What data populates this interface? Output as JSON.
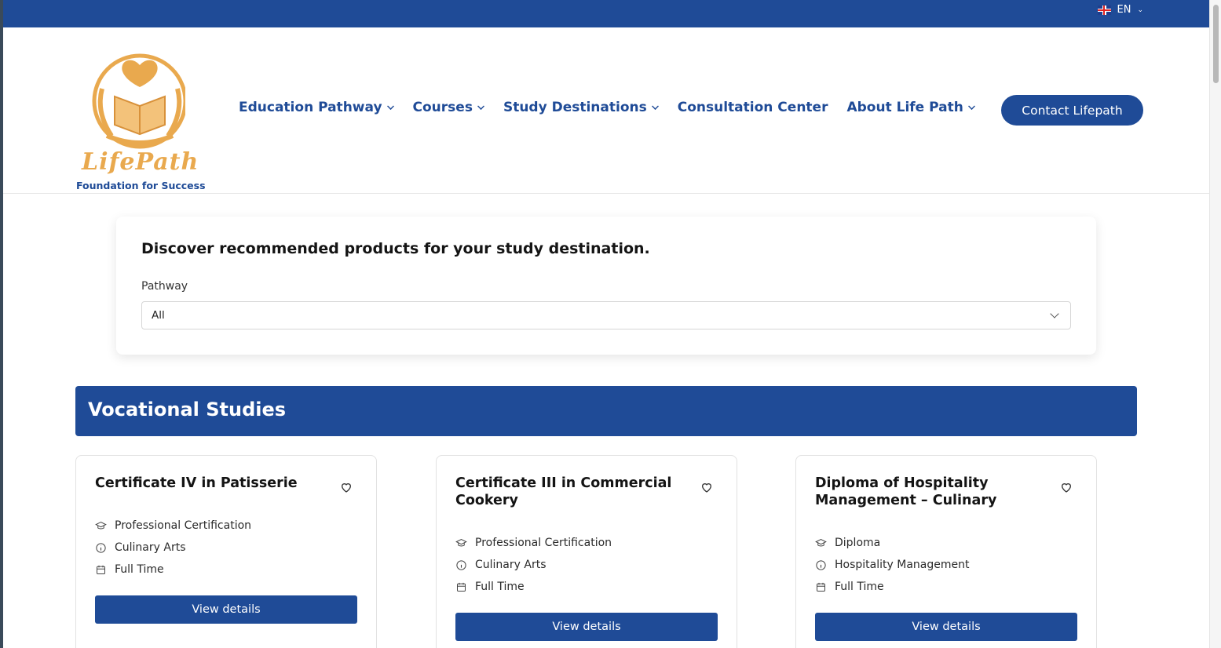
{
  "topbar": {
    "language": "EN",
    "flag_icon": "uk-flag-icon"
  },
  "logo": {
    "name": "LifePath",
    "tagline": "Foundation for Success"
  },
  "nav": {
    "items": [
      {
        "label": "Education Pathway",
        "has_dropdown": true
      },
      {
        "label": "Courses",
        "has_dropdown": true
      },
      {
        "label": "Study Destinations",
        "has_dropdown": true
      },
      {
        "label": "Consultation Center",
        "has_dropdown": false
      },
      {
        "label": "About Life Path",
        "has_dropdown": true
      }
    ],
    "contact_label": "Contact Lifepath"
  },
  "filter": {
    "title": "Discover recommended products for your study destination.",
    "pathway_label": "Pathway",
    "pathway_value": "All"
  },
  "section": {
    "title": "Vocational Studies"
  },
  "cards": [
    {
      "title": "Certificate IV in Patisserie",
      "level": "Professional Certification",
      "field": "Culinary Arts",
      "mode": "Full Time",
      "button": "View details"
    },
    {
      "title": "Certificate III in Commercial Cookery",
      "level": "Professional Certification",
      "field": "Culinary Arts",
      "mode": "Full Time",
      "button": "View details"
    },
    {
      "title": "Diploma of Hospitality Management – Culinary",
      "level": "Diploma",
      "field": "Hospitality Management",
      "mode": "Full Time",
      "button": "View details"
    }
  ],
  "colors": {
    "brand": "#1f4b97",
    "logo_gold": "#e9a94e"
  }
}
